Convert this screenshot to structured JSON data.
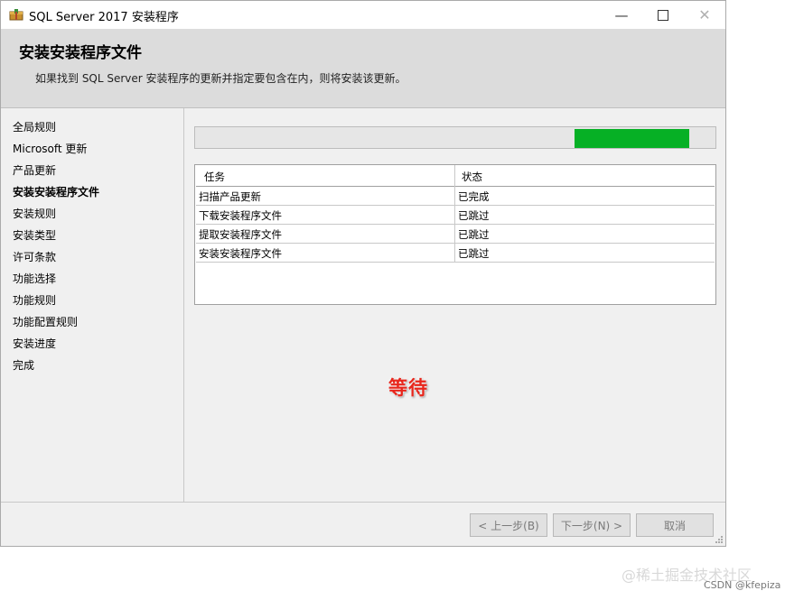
{
  "window": {
    "title": "SQL Server 2017 安装程序",
    "controls": {
      "minimize": "—",
      "close": "✕"
    }
  },
  "header": {
    "title": "安装安装程序文件",
    "subtitle": "如果找到 SQL Server 安装程序的更新并指定要包含在内，则将安装该更新。"
  },
  "sidebar": {
    "items": [
      {
        "label": "全局规则"
      },
      {
        "label": "Microsoft 更新"
      },
      {
        "label": "产品更新"
      },
      {
        "label": "安装安装程序文件",
        "active": true
      },
      {
        "label": "安装规则"
      },
      {
        "label": "安装类型"
      },
      {
        "label": "许可条款"
      },
      {
        "label": "功能选择"
      },
      {
        "label": "功能规则"
      },
      {
        "label": "功能配置规则"
      },
      {
        "label": "安装进度"
      },
      {
        "label": "完成"
      }
    ]
  },
  "progress": {
    "value": 0.95,
    "color": "#06b025"
  },
  "task_table": {
    "headers": [
      "任务",
      "状态"
    ],
    "rows": [
      [
        "扫描产品更新",
        "已完成"
      ],
      [
        "下载安装程序文件",
        "已跳过"
      ],
      [
        "提取安装程序文件",
        "已跳过"
      ],
      [
        "安装安装程序文件",
        "已跳过"
      ]
    ]
  },
  "annotation": {
    "text": "等待",
    "color": "#e8261c"
  },
  "footer": {
    "back_label": "< 上一步(B)",
    "next_label": "下一步(N) >",
    "cancel_label": "取消"
  },
  "watermark": {
    "line1": "@稀土掘金技术社区",
    "line2": "CSDN @kfepiza"
  }
}
